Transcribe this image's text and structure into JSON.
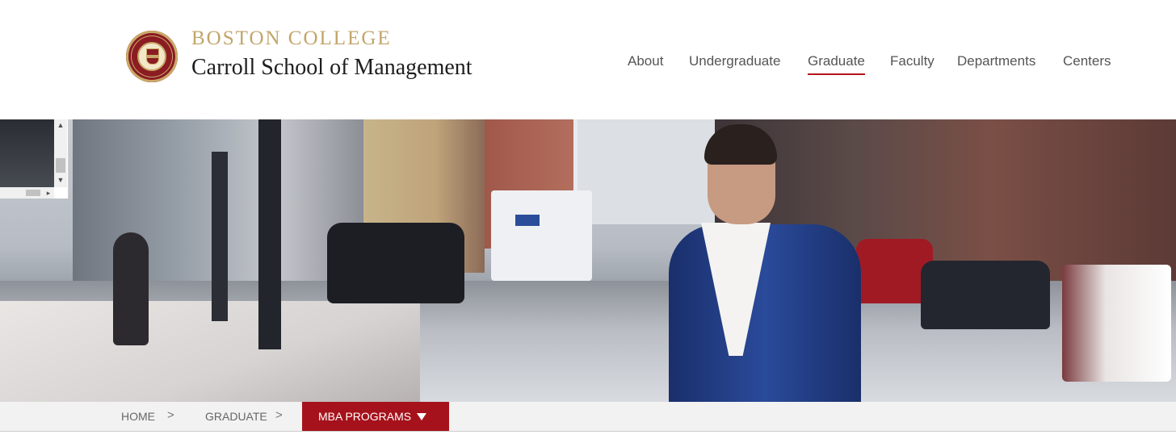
{
  "brand": {
    "line1": "BOSTON COLLEGE",
    "line2": "Carroll School of Management",
    "accent_color": "#c2a56a",
    "seal_color": "#8a1c22"
  },
  "nav": {
    "items": [
      {
        "label": "About"
      },
      {
        "label": "Undergraduate"
      },
      {
        "label": "Graduate",
        "active": true
      },
      {
        "label": "Faculty"
      },
      {
        "label": "Departments"
      },
      {
        "label": "Centers"
      }
    ],
    "active_underline_color": "#b5121b"
  },
  "scroll_widget": {
    "up_arrow": "▲",
    "down_arrow": "▼",
    "right_arrow": "▸"
  },
  "breadcrumb": {
    "items": [
      {
        "label": "HOME"
      },
      {
        "label": "GRADUATE"
      }
    ],
    "separator": ">",
    "current": {
      "label": "MBA PROGRAMS",
      "icon": "caret-down-icon"
    },
    "current_bg_color": "#a6121b"
  }
}
